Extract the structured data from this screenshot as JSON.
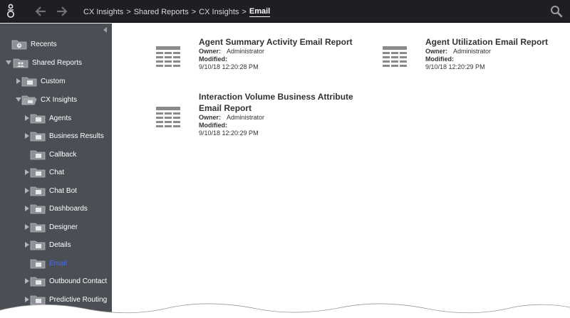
{
  "topbar": {
    "breadcrumbs": [
      "CX Insights",
      "Shared Reports",
      "CX Insights"
    ],
    "current": "Email",
    "separator": ">"
  },
  "sidebar": {
    "items": [
      {
        "label": "Recents"
      },
      {
        "label": "Shared Reports"
      },
      {
        "label": "Custom"
      },
      {
        "label": "CX Insights"
      },
      {
        "label": "Agents"
      },
      {
        "label": "Business Results"
      },
      {
        "label": "Callback"
      },
      {
        "label": "Chat"
      },
      {
        "label": "Chat Bot"
      },
      {
        "label": "Dashboards"
      },
      {
        "label": "Designer"
      },
      {
        "label": "Details"
      },
      {
        "label": "Email"
      },
      {
        "label": "Outbound Contact"
      },
      {
        "label": "Predictive Routing"
      }
    ],
    "selected": "Email"
  },
  "reports": [
    {
      "title": "Agent Summary Activity Email Report",
      "owner_label": "Owner:",
      "owner": "Administrator",
      "modified_label": "Modified:",
      "modified": "9/10/18 12:20:28 PM"
    },
    {
      "title": "Agent Utilization Email Report",
      "owner_label": "Owner:",
      "owner": "Administrator",
      "modified_label": "Modified:",
      "modified": "9/10/18 12:20:29 PM"
    },
    {
      "title_line1": "Interaction Volume Business Attribute",
      "title_line2": "Email Report",
      "owner_label": "Owner:",
      "owner": "Administrator",
      "modified_label": "Modified:",
      "modified": "9/10/18 12:20:29 PM"
    }
  ],
  "colors": {
    "topbar": "#1e1f22",
    "sidebar": "#4b4e54",
    "selected": "#4a6de0"
  }
}
